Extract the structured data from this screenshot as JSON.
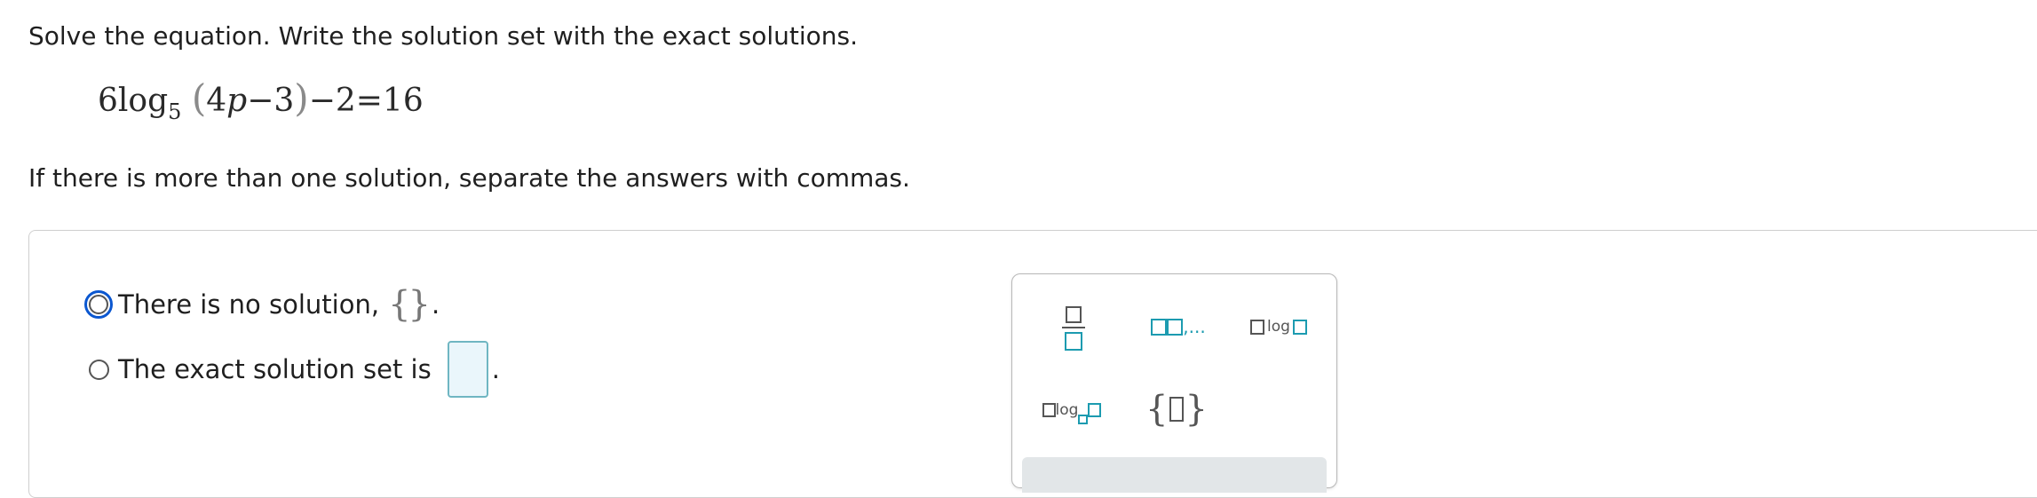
{
  "question": {
    "instruction": "Solve the equation. Write the solution set with the exact solutions.",
    "equation": {
      "coefficient": "6",
      "func": "log",
      "base": "5",
      "open_paren": "(",
      "arg_coef": "4",
      "variable": "p",
      "arg_rest": "−3",
      "close_paren": ")",
      "rest": "−2=16"
    },
    "note": "If there is more than one solution, separate the answers with commas."
  },
  "options": [
    {
      "label": "There is no solution,",
      "suffix": "{}",
      "end": ".",
      "selected": false,
      "focused": true
    },
    {
      "label": "The exact solution set is",
      "answer_value": "",
      "end": ".",
      "selected": false,
      "focused": false
    }
  ],
  "palette": {
    "list_text": ",...",
    "log_text": "log",
    "logbase_text": "log",
    "brace_open": "{",
    "brace_close": "}"
  },
  "colors": {
    "focus_ring": "#0b57d0",
    "answer_box_fill": "#eaf6fb",
    "answer_box_border": "#6fb6c2",
    "palette_accent": "#1c9bb0"
  }
}
